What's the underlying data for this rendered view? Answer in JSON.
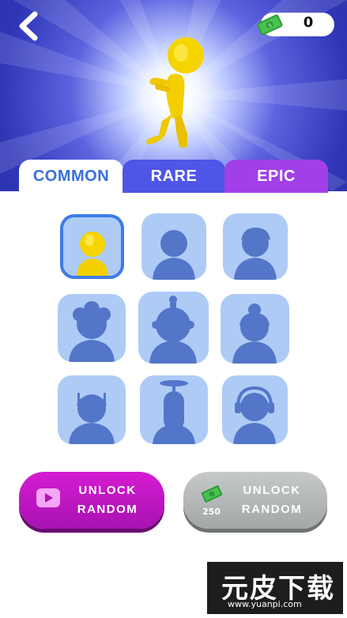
{
  "header": {
    "back_icon": "chevron-left-icon",
    "currency": {
      "icon": "cash-icon",
      "value": "0"
    },
    "preview_character": "yellow-stickman-icon"
  },
  "tabs": [
    {
      "label": "COMMON",
      "state": "active"
    },
    {
      "label": "RARE",
      "state": "inactive"
    },
    {
      "label": "EPIC",
      "state": "inactive"
    }
  ],
  "skins": [
    {
      "status": "selected",
      "icon": "yellow-character-icon"
    },
    {
      "status": "locked",
      "icon": "silhouette-plain-icon"
    },
    {
      "status": "locked",
      "icon": "silhouette-short-hair-icon"
    },
    {
      "status": "locked",
      "icon": "silhouette-curly-hair-icon"
    },
    {
      "status": "locked",
      "icon": "silhouette-diver-helmet-icon"
    },
    {
      "status": "locked",
      "icon": "silhouette-bun-hair-icon"
    },
    {
      "status": "locked",
      "icon": "silhouette-antenna-icon"
    },
    {
      "status": "locked",
      "icon": "silhouette-propeller-hat-icon"
    },
    {
      "status": "locked",
      "icon": "silhouette-headphones-icon"
    }
  ],
  "buttons": {
    "ad_unlock": {
      "line1": "UNLOCK",
      "line2": "RANDOM",
      "icon": "video-ad-icon"
    },
    "cash_unlock": {
      "line1": "UNLOCK",
      "line2": "RANDOM",
      "cost": "250",
      "icon": "cash-icon"
    }
  },
  "watermark": {
    "cn": "元皮下载",
    "url": "www.yuanpi.com"
  },
  "colors": {
    "header_bg": "#2f36b7",
    "tab_common": "#ffffff",
    "tab_rare": "#4f55e6",
    "tab_epic": "#a23fe8",
    "card_bg": "#aecbf6",
    "silhouette": "#5476c9",
    "selected_border": "#3e7be6",
    "ad_button": "#c118c4",
    "cash_button": "#b4b8b8"
  }
}
